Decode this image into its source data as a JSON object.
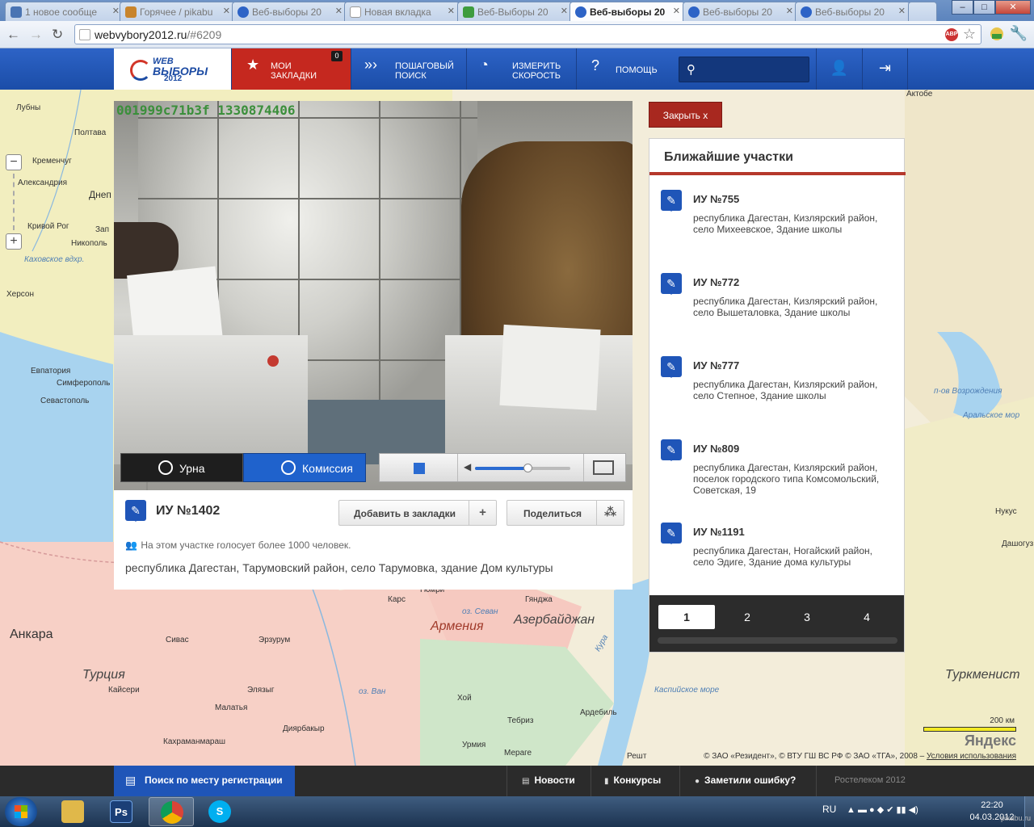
{
  "browser": {
    "tabs": [
      {
        "title": "1 новое сообще",
        "icon_color": "#4a74b3"
      },
      {
        "title": "Горячее / pikabu",
        "icon_color": "#c8842c"
      },
      {
        "title": "Веб-выборы 20",
        "icon_color": "#2d63c6"
      },
      {
        "title": "Новая вкладка",
        "icon_color": "#ffffff"
      },
      {
        "title": "Веб-Выборы 20",
        "icon_color": "#3e9c3e"
      },
      {
        "title": "Веб-выборы 20",
        "icon_color": "#2d63c6",
        "active": true
      },
      {
        "title": "Веб-выборы 20",
        "icon_color": "#2d63c6"
      },
      {
        "title": "Веб-выборы 20",
        "icon_color": "#2d63c6"
      }
    ],
    "url_host": "webvybory2012.ru",
    "url_rest": "/#6209",
    "window_controls": {
      "minimize": "–",
      "maximize": "□",
      "close": "✕"
    }
  },
  "site": {
    "logo_top": "WEB",
    "logo_mid": "ВЫБОРЫ",
    "logo_year": "2012",
    "nav": {
      "bookmarks_line1": "Мои",
      "bookmarks_line2": "закладки",
      "bookmarks_count": "0",
      "stepsearch_line1": "Пошаговый",
      "stepsearch_line2": "поиск",
      "speed_line1": "Измерить",
      "speed_line2": "скорость",
      "help": "Помощь"
    }
  },
  "video": {
    "stamp": "001999c71b3f 1330874406",
    "tab_urna": "Урна",
    "tab_komissiya": "Комиссия",
    "volume": 0.55
  },
  "station": {
    "title": "ИУ №1402",
    "add_bookmark": "Добавить в закладки",
    "share": "Поделиться",
    "voters_note": "На этом участке голосует более 1000 человек.",
    "address": "республика Дагестан, Тарумовский район, село Тарумовка, здание Дом культуры"
  },
  "nearby": {
    "close_label": "Закрыть x",
    "heading": "Ближайшие участки",
    "items": [
      {
        "title": "ИУ №755",
        "address": "республика Дагестан, Кизлярский район, село Михеевское, Здание школы"
      },
      {
        "title": "ИУ №772",
        "address": "республика Дагестан, Кизлярский район, село Вышеталовка, Здание школы"
      },
      {
        "title": "ИУ №777",
        "address": "республика Дагестан, Кизлярский район, село Степное, Здание школы"
      },
      {
        "title": "ИУ №809",
        "address": "республика Дагестан, Кизлярский район, поселок городского типа Комсомольский, Советская, 19"
      },
      {
        "title": "ИУ №1191",
        "address": "республика Дагестан, Ногайский район, село Эдиге, Здание дома культуры"
      }
    ],
    "pages": [
      "1",
      "2",
      "3",
      "4"
    ]
  },
  "map": {
    "labels": {
      "lubny": "Лубны",
      "poltava": "Полтава",
      "kremenchug": "Кременчуг",
      "aleksandriya": "Александрия",
      "dnepr": "Днеп",
      "krivoy_rog": "Кривой Рог",
      "zap": "Зап",
      "nikopol": "Никополь",
      "kakhovskoe": "Каховское вдхр.",
      "herson": "Херсон",
      "evpatoriya": "Евпатория",
      "simferopol": "Симферополь",
      "sevastopol": "Севастополь",
      "ankara": "Анкара",
      "turtsiya": "Турция",
      "kars": "Карс",
      "gyumri": "Гюмри",
      "gyandzha": "Гянджа",
      "armeniya": "Армения",
      "azerbaydzhan": "Азербайджан",
      "erzurum": "Эрзурум",
      "sivas": "Сивас",
      "kayseri": "Кайсери",
      "elyazig": "Элязыг",
      "malatya": "Малатья",
      "diyarbakyr": "Диярбакыр",
      "kahramanmarash": "Кахраманмараш",
      "khoy": "Хой",
      "tebriz": "Тебриз",
      "urmiya": "Урмия",
      "merage": "Мераге",
      "ardebil": "Ардебиль",
      "resht": "Решт",
      "kaspiyskoe": "Каспийское море",
      "turkmenist": "Туркменист",
      "aktobe": "Актобе",
      "nukus": "Нукус",
      "dashoguz": "Дашогуз",
      "vozrozhdeniya": "п-ов Возрождения",
      "aralskoe": "Аральское мор",
      "ozero_sevan": "оз. Севан",
      "ozero_van": "оз. Ван",
      "kura": "Кура"
    },
    "scale": "200 км",
    "logo": "Яндекс",
    "copyright": "© ЗАО «Резидент», © ВТУ ГШ ВС РФ © ЗАО «ТГА», 2008 –",
    "terms": "Условия использования"
  },
  "footer": {
    "reg_search": "Поиск по месту регистрации",
    "news": "Новости",
    "contests": "Конкурсы",
    "report": "Заметили ошибку?",
    "rostelecom": "Ростелеком 2012"
  },
  "taskbar": {
    "lang": "RU",
    "time": "22:20",
    "date": "04.03.2012",
    "watermark": "pikabu.ru"
  },
  "colors": {
    "header_blue": "#2d63c6",
    "bookmarks_red": "#c5281f",
    "accent_red": "#b5382b",
    "pin_blue": "#1f55b8"
  }
}
